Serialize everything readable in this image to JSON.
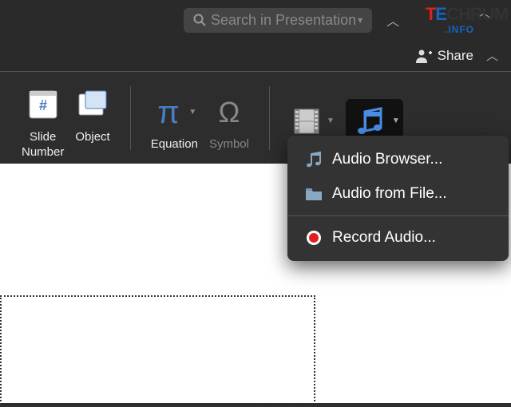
{
  "search": {
    "placeholder": "Search in Presentation"
  },
  "share": {
    "label": "Share"
  },
  "ribbon": {
    "slideNumber": "Slide\nNumber",
    "object": "Object",
    "equation": "Equation",
    "symbol": "Symbol"
  },
  "menu": {
    "audioBrowser": "Audio Browser...",
    "audioFromFile": "Audio from File...",
    "recordAudio": "Record Audio..."
  },
  "watermark": {
    "brand": "TECHRUM",
    "sub": ".INFO"
  }
}
